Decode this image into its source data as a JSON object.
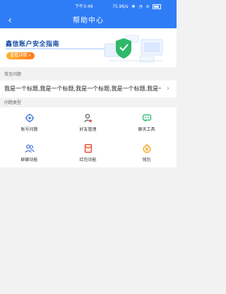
{
  "status": {
    "time": "下午3:49",
    "speed": "75.9K/s",
    "bluetooth": "✱",
    "signal": "◔",
    "wifi": "≋"
  },
  "header": {
    "title": "帮助中心",
    "back_icon": "‹"
  },
  "banner": {
    "title": "鑫信账户安全指南",
    "button_label": "查看详情 »"
  },
  "faq": {
    "section_title": "常见问题",
    "item_text": "我是一个标题,我是一个标题,我是一个标题,我是一个标题,我是一个标题,我是一个标题",
    "arrow": "›"
  },
  "types": {
    "section_title": "问题类型",
    "items": [
      {
        "label": "账号问题"
      },
      {
        "label": "好友管理"
      },
      {
        "label": "聊天工具"
      },
      {
        "label": "群聊功能"
      },
      {
        "label": "红包功能"
      },
      {
        "label": "钱包"
      }
    ]
  },
  "colors": {
    "primary": "#2f7df6",
    "accent": "#ff9a1f",
    "background": "#f2f2f2"
  }
}
